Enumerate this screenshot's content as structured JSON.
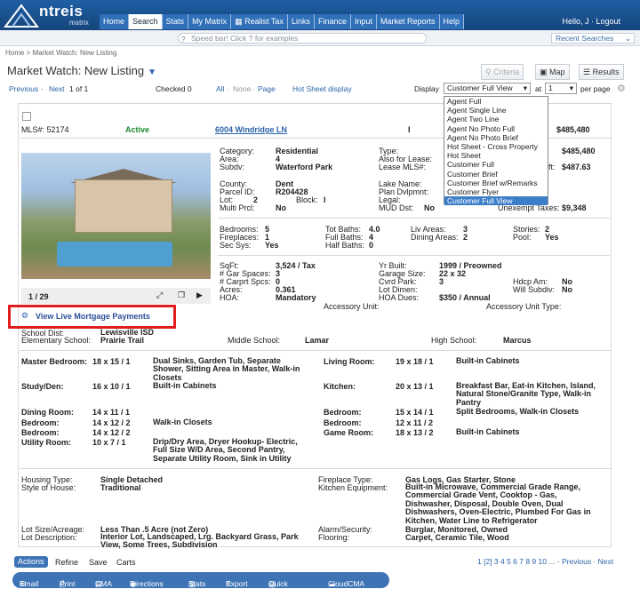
{
  "app": {
    "logo": "ntreis",
    "logo_sub": "matrix",
    "hello": "Hello, J · Logout"
  },
  "nav": [
    "Home",
    "Search",
    "Stats",
    "My Matrix",
    "Realist Tax",
    "Links",
    "Finance",
    "Input",
    "Market Reports",
    "Help"
  ],
  "speedbar": {
    "placeholder": "Speed bar! Click ? for examples",
    "recent": "Recent Searches"
  },
  "breadcrumb": "Home > Market Watch: New Listing",
  "title": "Market Watch: New Listing",
  "buttons": {
    "criteria": "Criteria",
    "map": "Map",
    "results": "Results"
  },
  "toolbar": {
    "prev": "Previous",
    "next": "Next",
    "of": "1 of 1",
    "checked": "Checked 0",
    "all": "All",
    "none": "None",
    "page": "Page",
    "hotsheet": "Hot Sheet display",
    "display": "Display",
    "display_value": "Customer Full View",
    "at": "at",
    "at_value": "1",
    "perpage": "per page"
  },
  "dropdown": [
    "Agent Full",
    "Agent Single Line",
    "Agent Two Line",
    "Agent No Photo Full",
    "Agent No Photo Brief",
    "Hot Sheet - Cross Property",
    "Hot Sheet",
    "Customer Full",
    "Customer Brief",
    "Customer Brief w/Remarks",
    "Customer Flyer",
    "Customer Full View"
  ],
  "listing": {
    "mls": "MLS#: 52174",
    "status": "Active",
    "address": "6004 Windridge LN",
    "price": "$485,480",
    "i": "I",
    "category_l": "Category:",
    "category": "Residential",
    "area_l": "Area:",
    "area": "4",
    "subdv_l": "Subdv:",
    "subdv": "Waterford Park",
    "county_l": "County:",
    "county": "Dent",
    "parcel_l": "Parcel ID:",
    "parcel": "R204428",
    "lot_l": "Lot:",
    "lot": "2",
    "block_l": "Block:",
    "block": "I",
    "multi_l": "Multi Prcl:",
    "multi": "No",
    "type_l": "Type:",
    "lease_l": "Also for Lease:",
    "leasemls_l": "Lease MLS#:",
    "lake_l": "Lake Name:",
    "plan_l": "Plan Dvlpmnt:",
    "legal_l": "Legal:",
    "mud_l": "MUD Dst:",
    "mud": "No",
    "price2": "$485,480",
    "sqft_tail": "ft:",
    "sqft_price": "$487.63",
    "unexempt_l": "Unexempt Taxes:",
    "unexempt": "$9,348",
    "beds_l": "Bedrooms:",
    "beds": "5",
    "fire_l": "Fireplaces:",
    "fire": "1",
    "secsys_l": "Sec Sys:",
    "secsys": "Yes",
    "totbath_l": "Tot Baths:",
    "totbath": "4.0",
    "fullbath_l": "Full Baths:",
    "fullbath": "4",
    "halfbath_l": "Half Baths:",
    "halfbath": "0",
    "liv_l": "Liv Areas:",
    "liv": "3",
    "dining_l": "Dining Areas:",
    "dining": "2",
    "stories_l": "Stories:",
    "stories": "2",
    "pool_l": "Pool:",
    "pool": "Yes",
    "sqft_l": "SqFt:",
    "sqft": "3,524 / Tax",
    "gar_l": "# Gar Spaces:",
    "gar": "3",
    "carport_l": "# Carprt Spcs:",
    "carport": "0",
    "acres_l": "Acres:",
    "acres": "0.361",
    "hoa_l": "HOA:",
    "hoa": "Mandatory",
    "yr_l": "Yr Built:",
    "yr": "1999 / Preowned",
    "garsize_l": "Garage Size:",
    "garsize": "22 x 32",
    "cvrd_l": "Cvrd Park:",
    "cvrd": "3",
    "lotdim_l": "Lot Dimen:",
    "hoadues_l": "HOA Dues:",
    "hoadues": "$350 / Annual",
    "hdcp_l": "Hdcp Am:",
    "hdcp": "No",
    "subdiv_l": "Will Subdiv:",
    "subdiv": "No",
    "acc_l": "Accessory Unit:",
    "acctype_l": "Accessory Unit Type:",
    "photocount": "1 / 29",
    "mortgage": "View Live Mortgage Payments",
    "school_l": "School Dist:",
    "school": "Lewisville ISD",
    "elem_l": "Elementary School:",
    "elem": "Prairie Trail",
    "mid_l": "Middle School:",
    "mid": "Lamar",
    "high_l": "High School:",
    "high": "Marcus"
  },
  "rooms": [
    {
      "n": "Master Bedroom:",
      "s": "18 x 15 / 1",
      "d": "Dual Sinks, Garden Tub, Separate Shower, Sitting Area in Master, Walk-in Closets"
    },
    {
      "n": "Study/Den:",
      "s": "16 x 10 / 1",
      "d": "Built-in Cabinets"
    },
    {
      "n": "Dining Room:",
      "s": "14 x 11 / 1",
      "d": ""
    },
    {
      "n": "Bedroom:",
      "s": "14 x 12 / 2",
      "d": "Walk-in Closets"
    },
    {
      "n": "Bedroom:",
      "s": "14 x 12 / 2",
      "d": ""
    },
    {
      "n": "Utility Room:",
      "s": "10 x 7 / 1",
      "d": "Drip/Dry Area, Dryer Hookup- Electric, Full Size W/D Area, Second Pantry, Separate Utility Room, Sink in Utility"
    },
    {
      "n": "Living Room:",
      "s": "19 x 18 / 1",
      "d": "Built-in Cabinets"
    },
    {
      "n": "Kitchen:",
      "s": "20 x 13 / 1",
      "d": "Breakfast Bar, Eat-in Kitchen, Island, Natural Stone/Granite Type, Walk-in Pantry"
    },
    {
      "n": "Bedroom:",
      "s": "15 x 14 / 1",
      "d": "Split Bedrooms, Walk-in Closets"
    },
    {
      "n": "Bedroom:",
      "s": "12 x 11 / 2",
      "d": ""
    },
    {
      "n": "Game Room:",
      "s": "18 x 13 / 2",
      "d": "Built-in Cabinets"
    }
  ],
  "features": {
    "housing_l": "Housing Type:",
    "housing": "Single Detached",
    "style_l": "Style of House:",
    "style": "Traditional",
    "fp_l": "Fireplace Type:",
    "fp": "Gas Logs, Gas Starter, Stone",
    "kit_l": "Kitchen Equipment:",
    "kit": "Built-in Microwave, Commercial Grade Range, Commercial Grade Vent, Cooktop - Gas, Dishwasher, Disposal, Double Oven, Dual Dishwashers, Oven-Electric, Plumbed For Gas in Kitchen, Water Line to Refrigerator",
    "lotsize_l": "Lot Size/Acreage:",
    "lotsize": "Less Than .5 Acre (not Zero)",
    "lotdesc_l": "Lot Description:",
    "lotdesc": "Interior Lot, Landscaped, Lrg. Backyard Grass, Park View, Some Trees, Subdivision",
    "alarm_l": "Alarm/Security:",
    "alarm": "Burglar, Monitored, Owned",
    "floor_l": "Flooring:",
    "floor": "Carpet, Ceramic Tile, Wood"
  },
  "footer": {
    "tabs": [
      "Actions",
      "Refine",
      "Save",
      "Carts"
    ],
    "actions": [
      "Email",
      "Print",
      "CMA",
      "Directions",
      "Stats",
      "Export",
      "Quick CMA",
      "CloudCMA"
    ],
    "pages": "1 [2] 3 4 5 6 7 8 9 10 ...",
    "prev": "Previous",
    "next": "Next"
  }
}
